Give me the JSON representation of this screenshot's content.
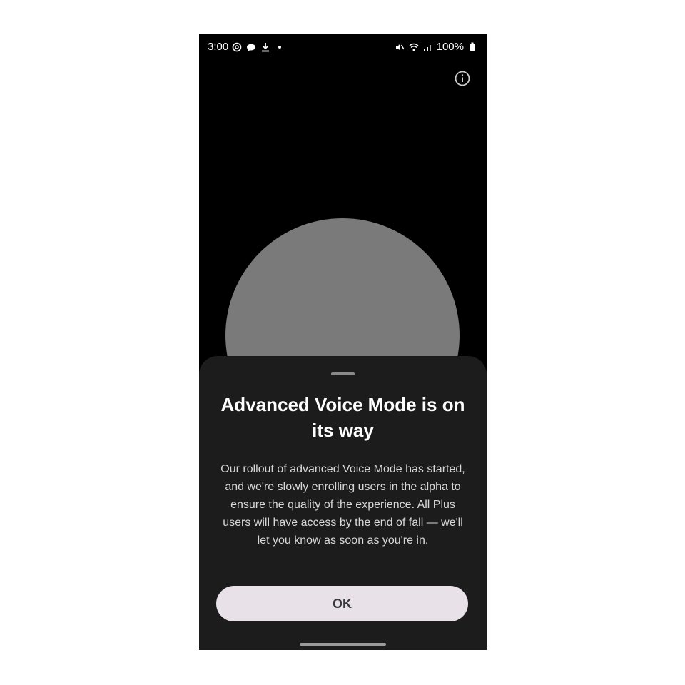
{
  "status_bar": {
    "time": "3:00",
    "battery": "100%",
    "left_icons": [
      "openai-icon",
      "messages-icon",
      "download-icon",
      "dot-icon"
    ],
    "right_icons": [
      "mute-icon",
      "wifi-icon",
      "signal-icon",
      "battery-icon"
    ]
  },
  "header": {
    "info_icon": "info-icon"
  },
  "sheet": {
    "title": "Advanced Voice Mode is on its way",
    "body": "Our rollout of advanced Voice Mode has started, and we're slowly enrolling users in the alpha to ensure the quality of the experience. All Plus users will have access by the end of fall — we'll let you know as soon as you're in.",
    "ok_label": "OK"
  },
  "colors": {
    "background": "#000000",
    "orb": "#7a7a7a",
    "sheet": "#1c1c1c",
    "button": "#e8e1e8"
  }
}
